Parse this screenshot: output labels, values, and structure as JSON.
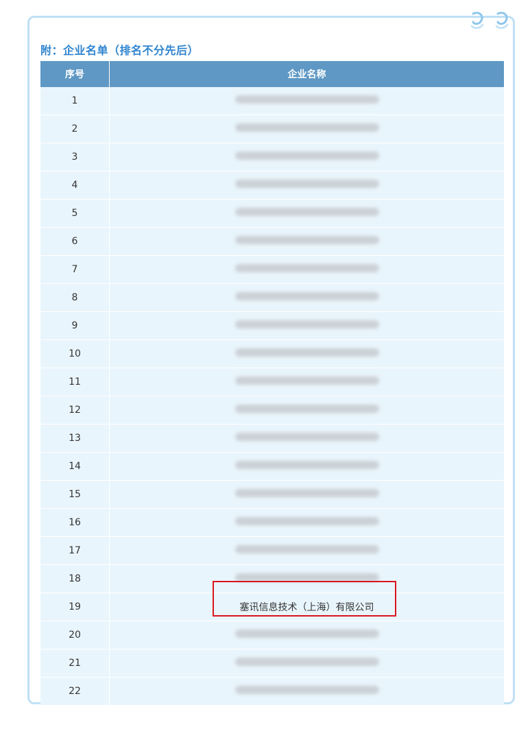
{
  "heading": "附：企业名单（排名不分先后）",
  "table": {
    "headers": [
      "序号",
      "企业名称"
    ],
    "rows": [
      {
        "no": "1",
        "name": "",
        "obscured": true
      },
      {
        "no": "2",
        "name": "",
        "obscured": true
      },
      {
        "no": "3",
        "name": "",
        "obscured": true
      },
      {
        "no": "4",
        "name": "",
        "obscured": true
      },
      {
        "no": "5",
        "name": "",
        "obscured": true
      },
      {
        "no": "6",
        "name": "",
        "obscured": true
      },
      {
        "no": "7",
        "name": "",
        "obscured": true
      },
      {
        "no": "8",
        "name": "",
        "obscured": true
      },
      {
        "no": "9",
        "name": "",
        "obscured": true
      },
      {
        "no": "10",
        "name": "",
        "obscured": true
      },
      {
        "no": "11",
        "name": "",
        "obscured": true
      },
      {
        "no": "12",
        "name": "",
        "obscured": true
      },
      {
        "no": "13",
        "name": "",
        "obscured": true
      },
      {
        "no": "14",
        "name": "",
        "obscured": true
      },
      {
        "no": "15",
        "name": "",
        "obscured": true
      },
      {
        "no": "16",
        "name": "",
        "obscured": true
      },
      {
        "no": "17",
        "name": "",
        "obscured": true
      },
      {
        "no": "18",
        "name": "",
        "obscured": true
      },
      {
        "no": "19",
        "name": "塞讯信息技术（上海）有限公司",
        "obscured": false,
        "highlighted": true
      },
      {
        "no": "20",
        "name": "",
        "obscured": true
      },
      {
        "no": "21",
        "name": "",
        "obscured": true
      },
      {
        "no": "22",
        "name": "",
        "obscured": true
      }
    ]
  },
  "colors": {
    "frame_border": "#bfe0f5",
    "heading": "#2f84d0",
    "header_bg": "#5f98c4",
    "row_bg": "#e9f5fc",
    "highlight_border": "#d9141e"
  },
  "icons": [
    "swirl-decoration-icon"
  ]
}
